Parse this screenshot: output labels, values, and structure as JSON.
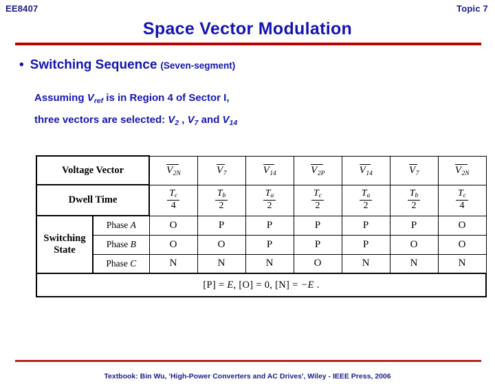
{
  "header": {
    "course_code": "EE8407",
    "topic": "Topic 7"
  },
  "title": "Space Vector Modulation",
  "bullet": {
    "dot": "•",
    "main": "Switching Sequence",
    "sub": "(Seven-segment)"
  },
  "paragraph": {
    "line1_pre": "Assuming ",
    "line1_v": "V",
    "line1_vsub": "ref",
    "line1_post": " is in Region 4 of Sector I,",
    "line2_pre": "three vectors are selected: ",
    "line2_v1": "V",
    "line2_v1sub": "2",
    "line2_mid1": " , ",
    "line2_v2": "V",
    "line2_v2sub": "7",
    "line2_mid2": " and ",
    "line2_v3": "V",
    "line2_v3sub": "14"
  },
  "table": {
    "row_labels": {
      "voltage_vector": "Voltage Vector",
      "dwell_time": "Dwell Time",
      "switching_state": "Switching\nState",
      "switching_state_l1": "Switching",
      "switching_state_l2": "State"
    },
    "phase_labels": [
      "Phase A",
      "Phase B",
      "Phase C"
    ],
    "phase_label_parts": [
      {
        "word": "Phase ",
        "letter": "A"
      },
      {
        "word": "Phase ",
        "letter": "B"
      },
      {
        "word": "Phase ",
        "letter": "C"
      }
    ],
    "voltage_vectors": [
      {
        "symbol": "V",
        "sub": "2N"
      },
      {
        "symbol": "V",
        "sub": "7"
      },
      {
        "symbol": "V",
        "sub": "14"
      },
      {
        "symbol": "V",
        "sub": "2P"
      },
      {
        "symbol": "V",
        "sub": "14"
      },
      {
        "symbol": "V",
        "sub": "7"
      },
      {
        "symbol": "V",
        "sub": "2N"
      }
    ],
    "dwell_times": [
      {
        "num": "T",
        "numsub": "c",
        "den": "4"
      },
      {
        "num": "T",
        "numsub": "b",
        "den": "2"
      },
      {
        "num": "T",
        "numsub": "a",
        "den": "2"
      },
      {
        "num": "T",
        "numsub": "c",
        "den": "2"
      },
      {
        "num": "T",
        "numsub": "a",
        "den": "2"
      },
      {
        "num": "T",
        "numsub": "b",
        "den": "2"
      },
      {
        "num": "T",
        "numsub": "c",
        "den": "4"
      }
    ],
    "switching_states": {
      "phase_a": [
        "O",
        "P",
        "P",
        "P",
        "P",
        "P",
        "O"
      ],
      "phase_b": [
        "O",
        "O",
        "P",
        "P",
        "P",
        "O",
        "O"
      ],
      "phase_c": [
        "N",
        "N",
        "N",
        "O",
        "N",
        "N",
        "N"
      ]
    },
    "equation": {
      "p_bracket": "[P]",
      "eq1": " = ",
      "e1": "E",
      "c1": ",  ",
      "o_bracket": "[O]",
      "eq2": " = ",
      "zero": "0",
      "c2": ",  ",
      "n_bracket": "[N]",
      "eq3": " = ",
      "minus_e": "−E",
      "period": " ."
    }
  },
  "footer": {
    "text": "Textbook: Bin Wu, 'High-Power Converters and AC Drives', Wiley - IEEE Press, 2006"
  },
  "colors": {
    "title_blue": "#1414b4",
    "header_blue": "#1a1a8c",
    "rule_red": "#c00000"
  }
}
